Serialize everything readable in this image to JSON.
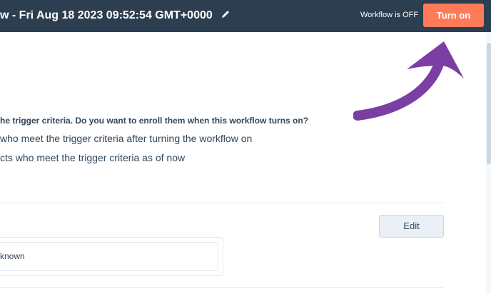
{
  "header": {
    "title": "w - Fri Aug 18 2023 09:52:54 GMT+0000",
    "workflow_status": "Workflow is OFF",
    "turn_on_label": "Turn on"
  },
  "enrollment": {
    "question": "he trigger criteria. Do you want to enroll them when this workflow turns on?",
    "option_1": "who meet the trigger criteria after turning the workflow on",
    "option_2": "cts who meet the trigger criteria as of now"
  },
  "section": {
    "edit_label": "Edit",
    "field_value": "known"
  },
  "colors": {
    "header_bg": "#2d3e50",
    "accent": "#ff7a59",
    "arrow": "#7b3fa3"
  }
}
